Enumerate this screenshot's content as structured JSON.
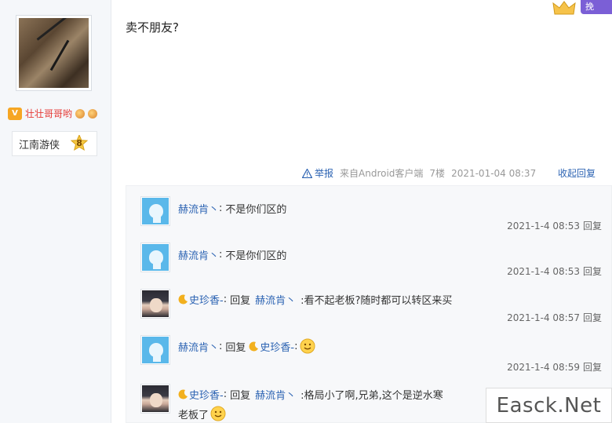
{
  "user": {
    "name": "壮壮哥哥哟",
    "vip_label": "V",
    "level_title": "江南游侠",
    "level": "8"
  },
  "topbar": {
    "button_label": "挽"
  },
  "post": {
    "text": "卖不朋友?",
    "report": "举报",
    "source": "来自Android客户端",
    "floor": "7楼",
    "datetime": "2021-01-04 08:37",
    "collapse": "收起回复"
  },
  "replies": [
    {
      "name": "赫流肯丶",
      "sep": ":",
      "content": "不是你们区的",
      "time": "2021-1-4 08:53",
      "reply_label": "回复"
    },
    {
      "name": "赫流肯丶",
      "sep": ":",
      "content": "不是你们区的",
      "time": "2021-1-4 08:53",
      "reply_label": "回复"
    },
    {
      "name": "史珍香-",
      "sep": ":",
      "prefix": "回复",
      "target": "赫流肯丶",
      "content": ":看不起老板?随时都可以转区来买",
      "time": "2021-1-4 08:57",
      "reply_label": "回复"
    },
    {
      "name": "赫流肯丶",
      "sep": ":",
      "prefix": "回复",
      "target": "史珍香-",
      "content": ":",
      "time": "2021-1-4 08:59",
      "reply_label": "回复"
    },
    {
      "name": "史珍香-",
      "sep": ":",
      "prefix": "回复",
      "target": "赫流肯丶",
      "content": ":格局小了啊,兄弟,这个是逆水寒",
      "content2": "老板了"
    }
  ],
  "watermark": "Easck.Net"
}
